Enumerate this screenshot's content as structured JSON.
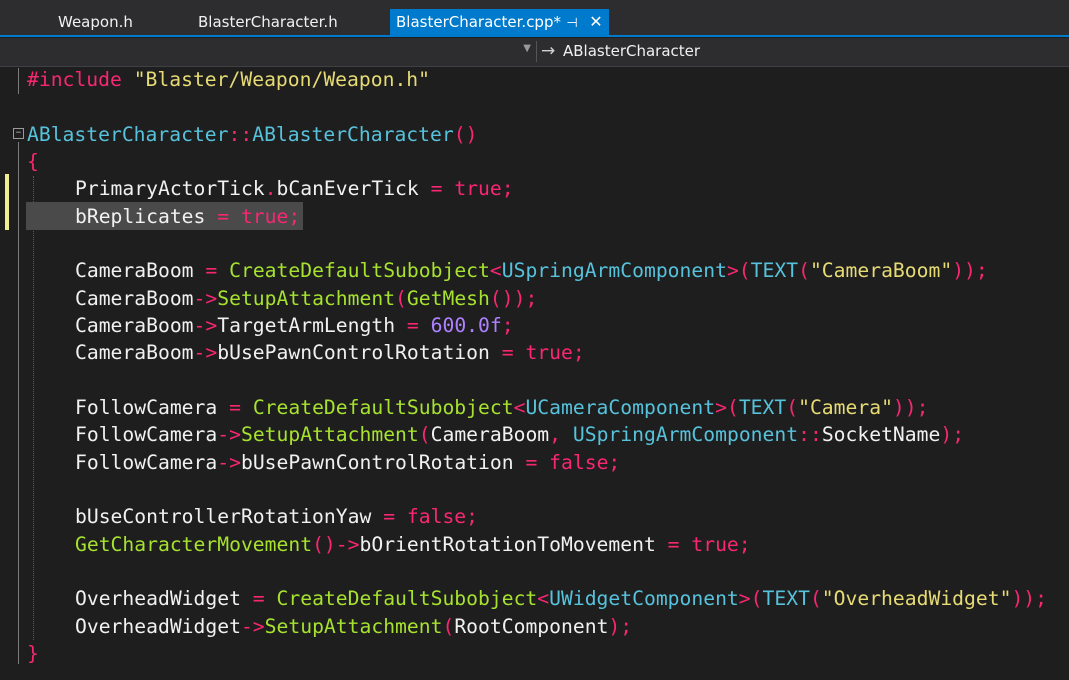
{
  "tabs": [
    {
      "label": "Weapon.h",
      "active": false
    },
    {
      "label": "BlasterCharacter.h",
      "active": false
    },
    {
      "label": "BlasterCharacter.cpp*",
      "active": true
    }
  ],
  "tab_icons": {
    "pin": "pin-icon",
    "close": "close-icon",
    "close_glyph": "✕",
    "pin_glyph": "⊣"
  },
  "navigation": {
    "left_scope": "",
    "right_scope": "ABlasterCharacter",
    "arrow_glyph": "→"
  },
  "colors": {
    "background": "#1e1e1e",
    "accent": "#007acc",
    "keyword_operator": "#f92672",
    "string": "#e6db74",
    "function": "#a6e22e",
    "type": "#56c2dc",
    "number": "#ae81ff",
    "default_text": "#f1f1f1",
    "change_marker": "#efef91",
    "selection": "#4a4a4a"
  },
  "code": {
    "line0": [
      {
        "t": "#include ",
        "c": "op"
      },
      {
        "t": "\"Blaster/Weapon/Weapon.h\"",
        "c": "str"
      }
    ],
    "line1": [],
    "line2": [
      {
        "t": "ABlasterCharacter",
        "c": "type"
      },
      {
        "t": "::",
        "c": "op"
      },
      {
        "t": "ABlasterCharacter",
        "c": "type"
      },
      {
        "t": "()",
        "c": "op"
      }
    ],
    "line3": [
      {
        "t": "{",
        "c": "op"
      }
    ],
    "line4": [
      {
        "t": "PrimaryActorTick",
        "c": "plain"
      },
      {
        "t": ".",
        "c": "op"
      },
      {
        "t": "bCanEverTick ",
        "c": "plain"
      },
      {
        "t": "= true;",
        "c": "op"
      }
    ],
    "line5": [
      {
        "t": "bReplicates ",
        "c": "plain"
      },
      {
        "t": "= true;",
        "c": "op"
      }
    ],
    "line6": [],
    "line7": [
      {
        "t": "CameraBoom ",
        "c": "plain"
      },
      {
        "t": "= ",
        "c": "op"
      },
      {
        "t": "CreateDefaultSubobject",
        "c": "func"
      },
      {
        "t": "<",
        "c": "op"
      },
      {
        "t": "USpringArmComponent",
        "c": "type"
      },
      {
        "t": ">(",
        "c": "op"
      },
      {
        "t": "TEXT",
        "c": "type"
      },
      {
        "t": "(",
        "c": "op"
      },
      {
        "t": "\"CameraBoom\"",
        "c": "str"
      },
      {
        "t": "));",
        "c": "op"
      }
    ],
    "line8": [
      {
        "t": "CameraBoom",
        "c": "plain"
      },
      {
        "t": "->",
        "c": "op"
      },
      {
        "t": "SetupAttachment",
        "c": "func"
      },
      {
        "t": "(",
        "c": "op"
      },
      {
        "t": "GetMesh",
        "c": "func"
      },
      {
        "t": "());",
        "c": "op"
      }
    ],
    "line9": [
      {
        "t": "CameraBoom",
        "c": "plain"
      },
      {
        "t": "->",
        "c": "op"
      },
      {
        "t": "TargetArmLength ",
        "c": "plain"
      },
      {
        "t": "= ",
        "c": "op"
      },
      {
        "t": "600.0f",
        "c": "num"
      },
      {
        "t": ";",
        "c": "op"
      }
    ],
    "line10": [
      {
        "t": "CameraBoom",
        "c": "plain"
      },
      {
        "t": "->",
        "c": "op"
      },
      {
        "t": "bUsePawnControlRotation ",
        "c": "plain"
      },
      {
        "t": "= true;",
        "c": "op"
      }
    ],
    "line11": [],
    "line12": [
      {
        "t": "FollowCamera ",
        "c": "plain"
      },
      {
        "t": "= ",
        "c": "op"
      },
      {
        "t": "CreateDefaultSubobject",
        "c": "func"
      },
      {
        "t": "<",
        "c": "op"
      },
      {
        "t": "UCameraComponent",
        "c": "type"
      },
      {
        "t": ">(",
        "c": "op"
      },
      {
        "t": "TEXT",
        "c": "type"
      },
      {
        "t": "(",
        "c": "op"
      },
      {
        "t": "\"Camera\"",
        "c": "str"
      },
      {
        "t": "));",
        "c": "op"
      }
    ],
    "line13": [
      {
        "t": "FollowCamera",
        "c": "plain"
      },
      {
        "t": "->",
        "c": "op"
      },
      {
        "t": "SetupAttachment",
        "c": "func"
      },
      {
        "t": "(",
        "c": "op"
      },
      {
        "t": "CameraBoom",
        "c": "plain"
      },
      {
        "t": ", ",
        "c": "op"
      },
      {
        "t": "USpringArmComponent",
        "c": "type"
      },
      {
        "t": "::",
        "c": "op"
      },
      {
        "t": "SocketName",
        "c": "plain"
      },
      {
        "t": ");",
        "c": "op"
      }
    ],
    "line14": [
      {
        "t": "FollowCamera",
        "c": "plain"
      },
      {
        "t": "->",
        "c": "op"
      },
      {
        "t": "bUsePawnControlRotation ",
        "c": "plain"
      },
      {
        "t": "= false;",
        "c": "op"
      }
    ],
    "line15": [],
    "line16": [
      {
        "t": "bUseControllerRotationYaw ",
        "c": "plain"
      },
      {
        "t": "= false;",
        "c": "op"
      }
    ],
    "line17": [
      {
        "t": "GetCharacterMovement",
        "c": "func"
      },
      {
        "t": "()->",
        "c": "op"
      },
      {
        "t": "bOrientRotationToMovement ",
        "c": "plain"
      },
      {
        "t": "= true;",
        "c": "op"
      }
    ],
    "line18": [],
    "line19": [
      {
        "t": "OverheadWidget ",
        "c": "plain"
      },
      {
        "t": "= ",
        "c": "op"
      },
      {
        "t": "CreateDefaultSubobject",
        "c": "func"
      },
      {
        "t": "<",
        "c": "op"
      },
      {
        "t": "UWidgetComponent",
        "c": "type"
      },
      {
        "t": ">(",
        "c": "op"
      },
      {
        "t": "TEXT",
        "c": "type"
      },
      {
        "t": "(",
        "c": "op"
      },
      {
        "t": "\"OverheadWidget\"",
        "c": "str"
      },
      {
        "t": "));",
        "c": "op"
      }
    ],
    "line20": [
      {
        "t": "OverheadWidget",
        "c": "plain"
      },
      {
        "t": "->",
        "c": "op"
      },
      {
        "t": "SetupAttachment",
        "c": "func"
      },
      {
        "t": "(",
        "c": "op"
      },
      {
        "t": "RootComponent",
        "c": "plain"
      },
      {
        "t": ");",
        "c": "op"
      }
    ],
    "line21": [
      {
        "t": "}",
        "c": "op"
      }
    ]
  }
}
